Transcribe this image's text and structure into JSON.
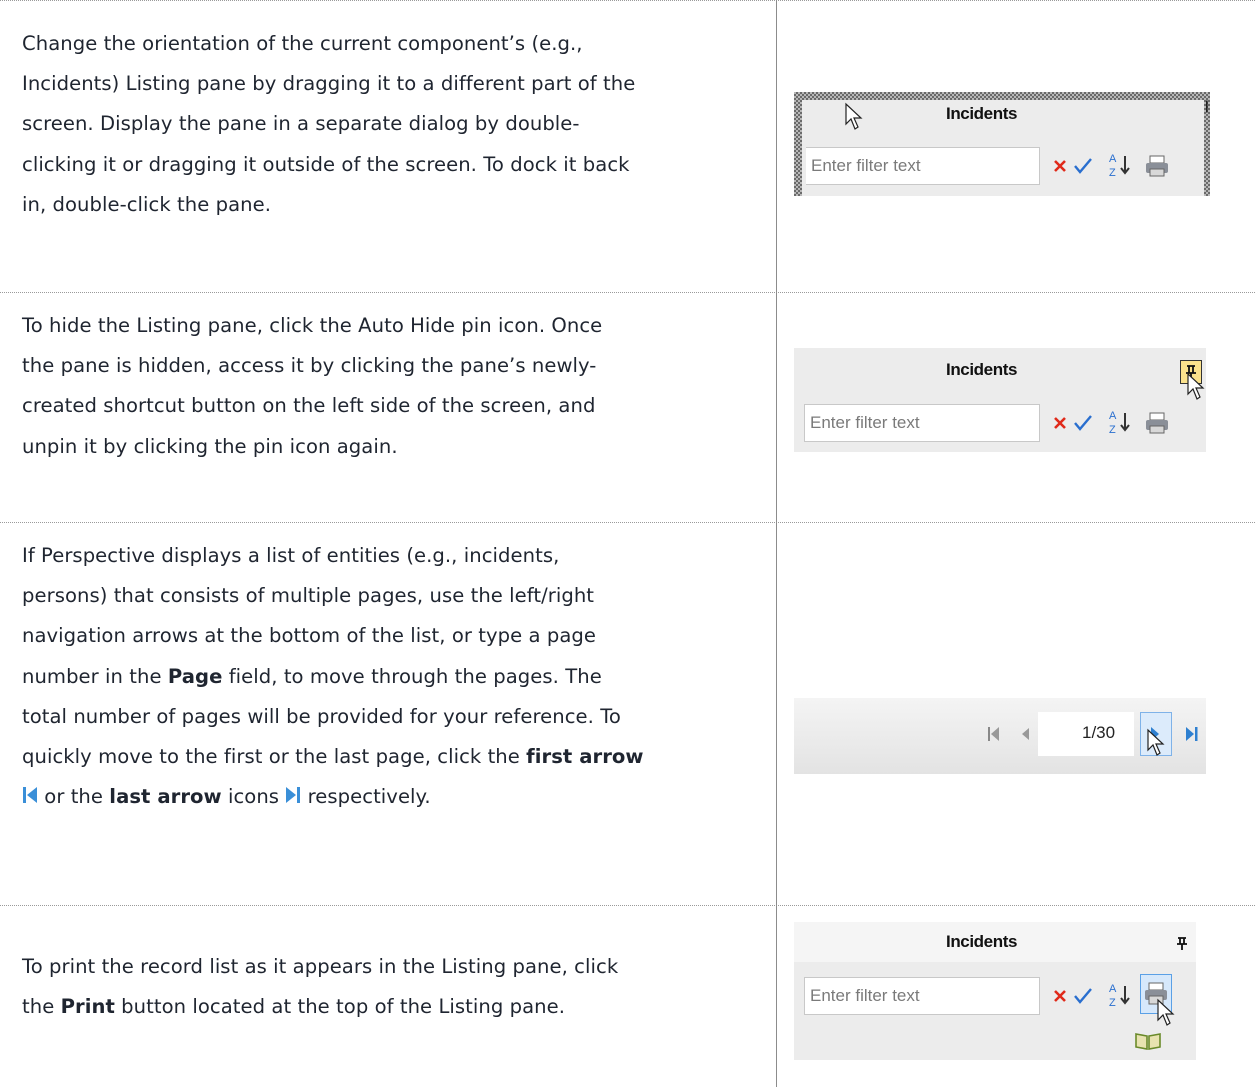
{
  "rows": [
    {
      "text": "Change the orientation of the current component’s (e.g., Incidents) Listing pane by dragging it to a different part of the screen. Display the pane in a separate dialog by double-clicking it or dragging it outside of the screen. To dock it back in, double-click the pane.",
      "lines": [
        "Change the orientation of the current component’s (e.g.,",
        "Incidents) Listing pane by dragging it to a different part of the",
        "screen. Display the pane in a separate dialog by double-",
        "clicking it or dragging it outside of the screen. To dock it back",
        "in, double-click the pane."
      ]
    },
    {
      "lines": [
        "To hide the Listing pane, click the Auto Hide pin icon. Once",
        "the pane is hidden, access it by clicking the pane’s newly-",
        "created shortcut button on the left side of the screen, and",
        "unpin it by clicking the pin icon again."
      ]
    },
    {
      "lines": [
        "If Perspective displays a list of entities (e.g., incidents,",
        "persons) that consists of multiple pages, use the left/right",
        "navigation arrows at the bottom of the list, or type a page"
      ],
      "l4a": "number in the ",
      "l4b": "Page",
      "l4c": " field, to move through the pages. The",
      "l5": "total number of pages will be provided for your reference. To",
      "l6a": "quickly move to the first or the last page, click the ",
      "l6b": "first arrow",
      "l7a": " or the ",
      "l7b": "last arrow",
      "l7c": " icons ",
      "l7d": " respectively."
    },
    {
      "l1": "To print the record list as it appears in the Listing pane, click",
      "l2a": "the ",
      "l2b": "Print",
      "l2c": " button located at the top of the Listing pane."
    }
  ],
  "pane": {
    "title": "Incidents",
    "filter_placeholder": "Enter filter text",
    "pin_glyph": "Ѩ",
    "page_value": "1/30"
  },
  "icons": [
    "cursor-arrow-icon",
    "clear-filter-icon",
    "apply-filter-icon",
    "sort-az-icon",
    "print-icon",
    "pin-icon",
    "first-page-icon",
    "previous-page-icon",
    "next-page-icon",
    "last-page-icon",
    "help-book-icon"
  ]
}
